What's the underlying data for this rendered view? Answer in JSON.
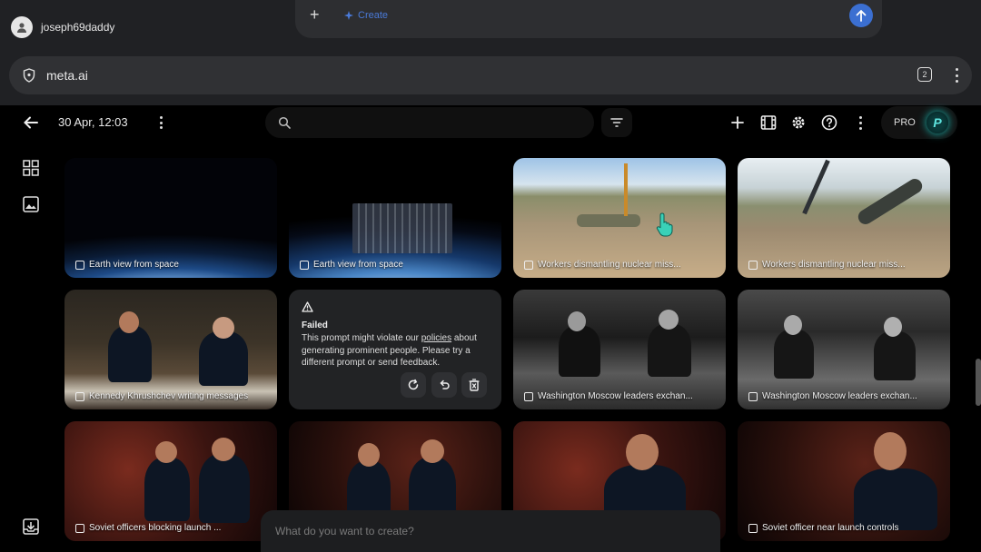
{
  "browser": {
    "account_name": "joseph69daddy",
    "composer_mode": "Create",
    "url": "meta.ai",
    "tab_count": "2"
  },
  "toolbar": {
    "date": "30 Apr, 12:03",
    "pro_label": "PRO"
  },
  "grid": {
    "cards": [
      {
        "caption": "Earth view from space"
      },
      {
        "caption": "Earth view from space"
      },
      {
        "caption": "Workers dismantling nuclear miss..."
      },
      {
        "caption": "Workers dismantling nuclear miss..."
      },
      {
        "caption": "Kennedy Khrushchev writing messages"
      },
      {
        "caption": "Washington Moscow leaders exchan..."
      },
      {
        "caption": "Washington Moscow leaders exchan..."
      },
      {
        "caption": "Soviet officers blocking launch ..."
      },
      {
        "caption": ""
      },
      {
        "caption": ""
      },
      {
        "caption": "Soviet officer near launch controls"
      }
    ],
    "failed": {
      "title": "Failed",
      "message_pre": "This prompt might violate our ",
      "message_link": "policies",
      "message_post": " about generating prominent people. Please try a different prompt or send feedback."
    }
  },
  "prompt": {
    "placeholder": "What do you want to create?"
  },
  "colors": {
    "accent": "#3b6fd1",
    "pro_glow": "#1bbdb7",
    "background": "#000000"
  }
}
